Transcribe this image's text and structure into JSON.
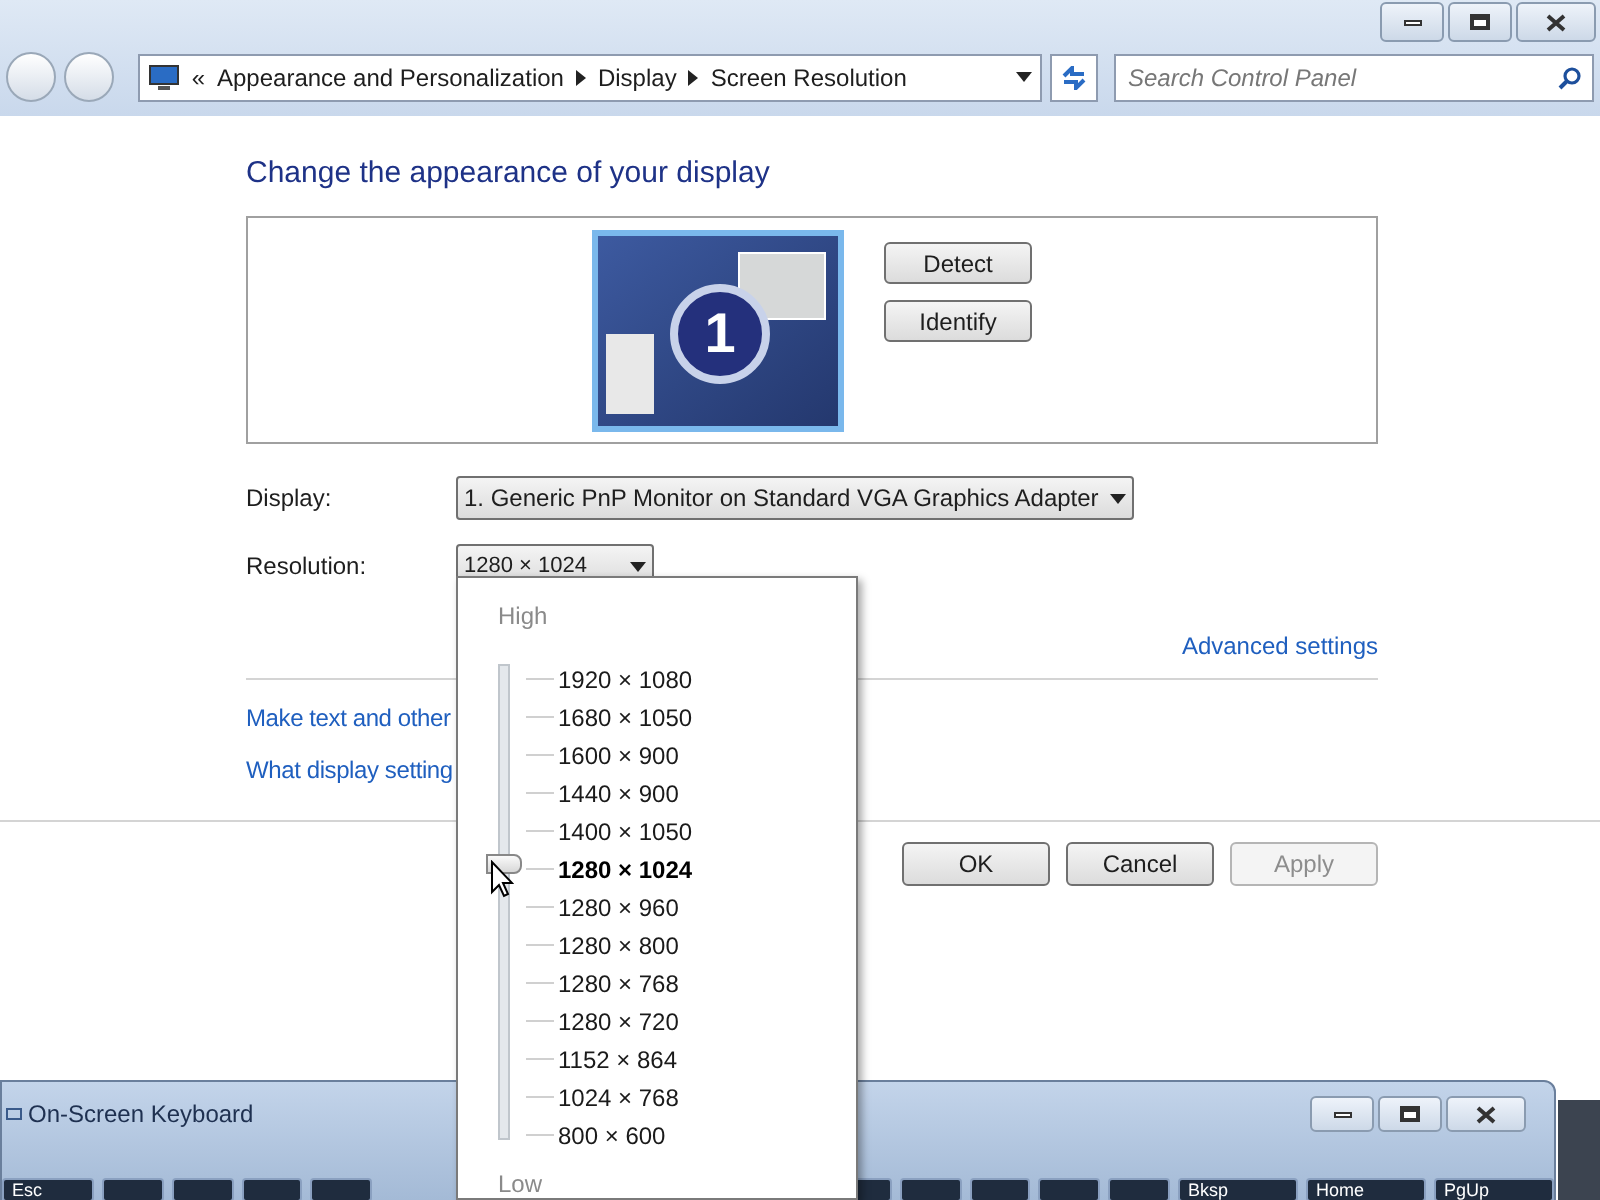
{
  "address_bar": {
    "overflow": "«",
    "path": [
      "Appearance and Personalization",
      "Display",
      "Screen Resolution"
    ],
    "search_placeholder": "Search Control Panel"
  },
  "heading": "Change the appearance of your display",
  "monitor": {
    "number": "1"
  },
  "preview_buttons": [
    "Detect",
    "Identify"
  ],
  "display": {
    "label": "Display:",
    "value": "1. Generic PnP Monitor on Standard VGA Graphics Adapter"
  },
  "resolution": {
    "label": "Resolution:",
    "value": "1280 × 1024",
    "level": 0.583,
    "high_label": "High",
    "low_label": "Low",
    "options": [
      {
        "label": "1920 × 1080",
        "selected": false
      },
      {
        "label": "1680 × 1050",
        "selected": false
      },
      {
        "label": "1600 × 900",
        "selected": false
      },
      {
        "label": "1440 × 900",
        "selected": false
      },
      {
        "label": "1400 × 1050",
        "selected": false
      },
      {
        "label": "1280 × 1024",
        "selected": true
      },
      {
        "label": "1280 × 960",
        "selected": false
      },
      {
        "label": "1280 × 800",
        "selected": false
      },
      {
        "label": "1280 × 768",
        "selected": false
      },
      {
        "label": "1280 × 720",
        "selected": false
      },
      {
        "label": "1152 × 864",
        "selected": false
      },
      {
        "label": "1024 × 768",
        "selected": false
      },
      {
        "label": "800 × 600",
        "selected": false
      }
    ]
  },
  "advanced_link": "Advanced settings",
  "links": [
    "Make text and other",
    "What display setting"
  ],
  "buttons": [
    {
      "label": "OK",
      "disabled": false
    },
    {
      "label": "Cancel",
      "disabled": false
    },
    {
      "label": "Apply",
      "disabled": true
    }
  ],
  "keyboard_window": {
    "title": "On-Screen Keyboard",
    "keys": [
      "Esc",
      "Bksp",
      "Home",
      "PgUp"
    ]
  }
}
